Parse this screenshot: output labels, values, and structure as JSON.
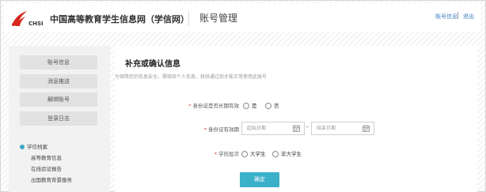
{
  "header": {
    "logo_mark_text": "CHSI",
    "logo_cn": "中国高等教育学生信息网（学信网）",
    "title": "账号管理",
    "link_account": "账号信息",
    "link_logout": "退出"
  },
  "sidebar": {
    "buttons": [
      "账号信息",
      "消息推送",
      "解绑账号",
      "登录日志"
    ],
    "tree_header": "学信档案",
    "tree_items": [
      "高等教育信息",
      "在线验证报告",
      "出国教育背景服务"
    ]
  },
  "main": {
    "title": "补充或确认信息",
    "description": "为保障您的信息安全，需核验个人信息，核验通过后才能正常使用此账号",
    "fields": {
      "long_term_label": "身份证是否长期有效",
      "long_term_options": [
        "是",
        "否"
      ],
      "validity_label": "身份证有效期",
      "start_placeholder": "起始日期",
      "end_placeholder": "结束日期",
      "dash": "-",
      "education_label": "学历层次",
      "education_options": [
        "大学生",
        "非大学生"
      ]
    },
    "confirm_label": "确定"
  },
  "colors": {
    "accent": "#3bb0c9",
    "link": "#3d7fc1",
    "required": "#e0443a"
  }
}
